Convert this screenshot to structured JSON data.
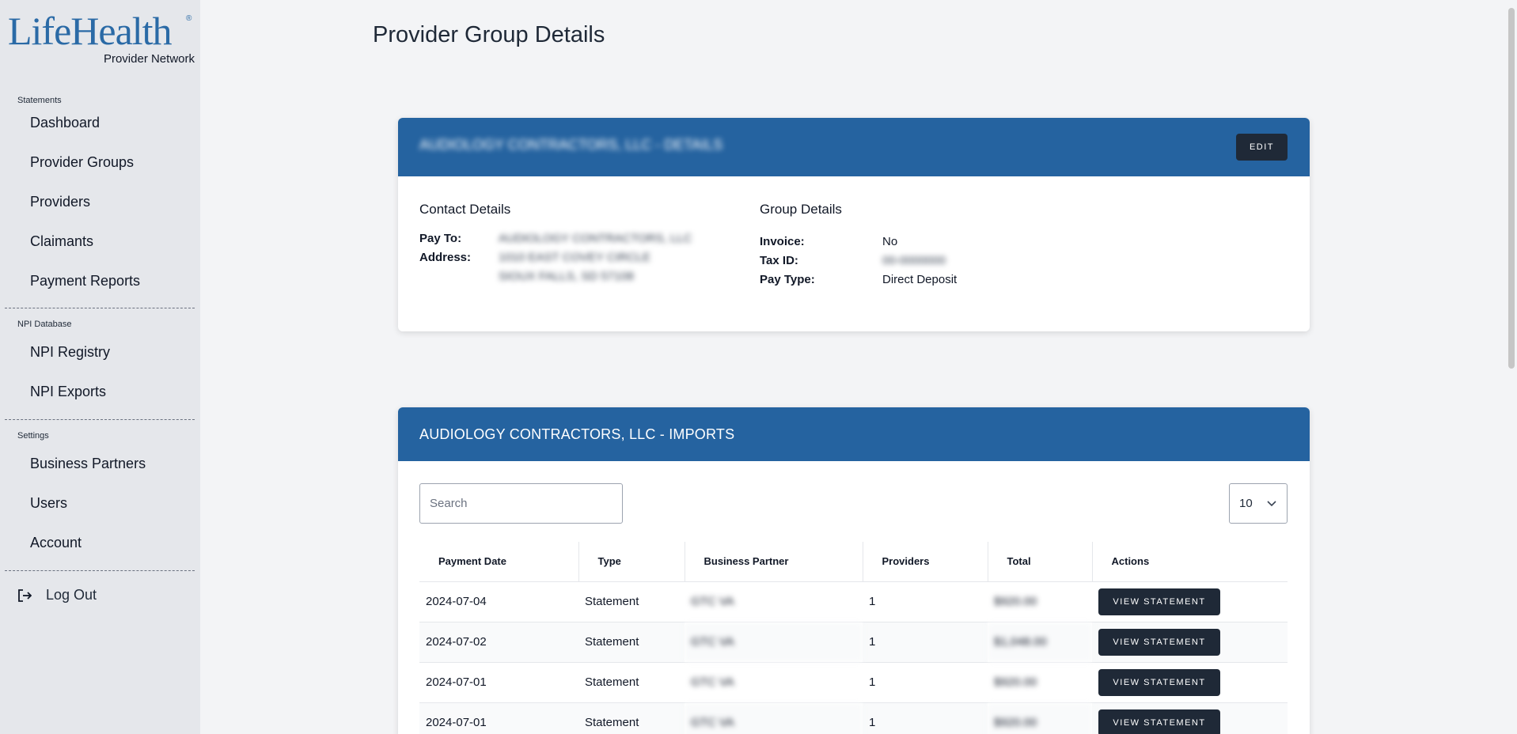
{
  "brand": {
    "name": "LifeHealth",
    "registered": "®",
    "subtitle": "Provider Network"
  },
  "sidebar": {
    "sections": [
      {
        "label": "Statements",
        "items": [
          "Dashboard",
          "Provider Groups",
          "Providers",
          "Claimants",
          "Payment Reports"
        ]
      },
      {
        "label": "NPI Database",
        "items": [
          "NPI Registry",
          "NPI Exports"
        ]
      },
      {
        "label": "Settings",
        "items": [
          "Business Partners",
          "Users",
          "Account"
        ]
      }
    ],
    "logout_label": "Log Out"
  },
  "page": {
    "title": "Provider Group Details"
  },
  "details_card": {
    "header_title": "AUDIOLOGY CONTRACTORS, LLC - DETAILS",
    "edit_label": "EDIT",
    "contact": {
      "heading": "Contact Details",
      "pay_to_label": "Pay To:",
      "pay_to_value": "AUDIOLOGY CONTRACTORS, LLC",
      "address_label": "Address:",
      "address_line1": "1010 EAST COVEY CIRCLE",
      "address_line2": "SIOUX FALLS, SD 57108"
    },
    "group": {
      "heading": "Group Details",
      "invoice_label": "Invoice:",
      "invoice_value": "No",
      "tax_id_label": "Tax ID:",
      "tax_id_value": "00-0000000",
      "pay_type_label": "Pay Type:",
      "pay_type_value": "Direct Deposit"
    }
  },
  "imports_card": {
    "header_title": "AUDIOLOGY CONTRACTORS, LLC - IMPORTS",
    "search_placeholder": "Search",
    "page_size": "10",
    "columns": [
      "Payment Date",
      "Type",
      "Business Partner",
      "Providers",
      "Total",
      "Actions"
    ],
    "rows": [
      {
        "date": "2024-07-04",
        "type": "Statement",
        "partner": "GTC VA",
        "providers": "1",
        "total": "$920.00",
        "action": "VIEW STATEMENT"
      },
      {
        "date": "2024-07-02",
        "type": "Statement",
        "partner": "GTC VA",
        "providers": "1",
        "total": "$1,048.00",
        "action": "VIEW STATEMENT"
      },
      {
        "date": "2024-07-01",
        "type": "Statement",
        "partner": "GTC VA",
        "providers": "1",
        "total": "$920.00",
        "action": "VIEW STATEMENT"
      },
      {
        "date": "2024-07-01",
        "type": "Statement",
        "partner": "GTC VA",
        "providers": "1",
        "total": "$920.00",
        "action": "VIEW STATEMENT"
      }
    ]
  },
  "colors": {
    "header_blue": "#2563a0",
    "button_dark": "#1f2937",
    "sidebar_bg": "#e5e7eb",
    "logo_blue": "#2a6aa6"
  },
  "icons": {
    "logout": "logout-arrow-icon",
    "dropdown": "chevron-down-icon"
  }
}
